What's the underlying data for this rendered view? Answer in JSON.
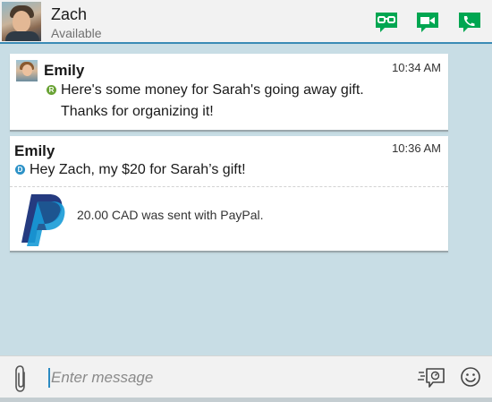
{
  "header": {
    "contact_name": "Zach",
    "contact_status": "Available",
    "accent_color": "#00a651",
    "actions": [
      {
        "icon": "bbm-video-glasses-icon"
      },
      {
        "icon": "video-call-icon"
      },
      {
        "icon": "voice-call-icon"
      }
    ]
  },
  "messages": [
    {
      "sender": "Emily",
      "time": "10:34 AM",
      "status": "R",
      "lines": [
        "Here's some money for Sarah's going away gift.",
        "Thanks for organizing it!"
      ]
    },
    {
      "sender": "Emily",
      "time": "10:36 AM",
      "status": "D",
      "text": "Hey Zach, my $20 for Sarah’s gift!",
      "payment_text": "20.00 CAD was sent with PayPal."
    }
  ],
  "composer": {
    "placeholder": "Enter message"
  }
}
